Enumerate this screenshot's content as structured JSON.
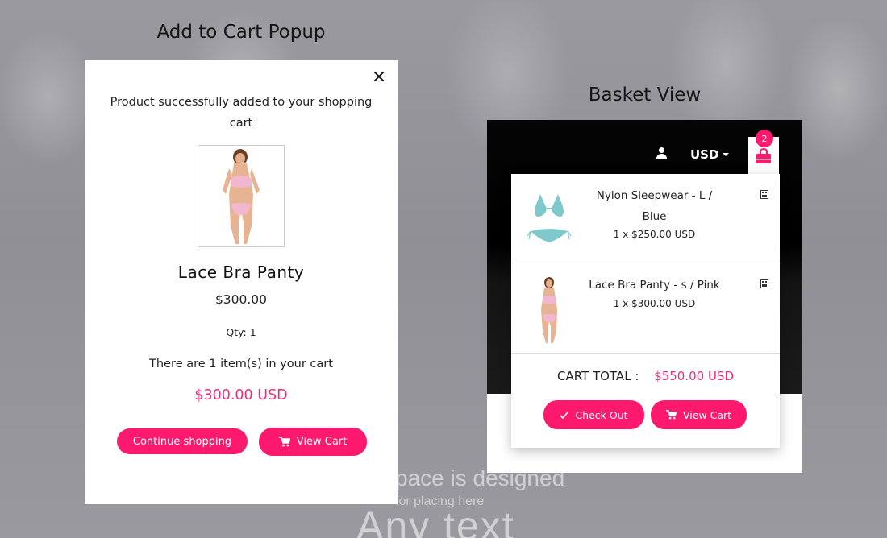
{
  "background": {
    "line1": "pace is designed",
    "line2": "for placing here",
    "line3": "Any  text"
  },
  "titles": {
    "popup": "Add to Cart Popup",
    "basket": "Basket View"
  },
  "popup": {
    "message": "Product successfully added to your shopping cart",
    "product_name": "Lace Bra Panty",
    "price": "$300.00",
    "qty": "Qty: 1",
    "cart_count": "There are 1 item(s) in your cart",
    "total": "$300.00 USD",
    "continue_label": "Continue shopping",
    "view_cart_label": "View Cart",
    "close_icon": "close-icon"
  },
  "basket": {
    "currency": "USD",
    "badge_count": "2",
    "items": [
      {
        "name": "Nylon Sleepwear - L / Blue",
        "price": "1 x $250.00 USD"
      },
      {
        "name": "Lace Bra Panty - s / Pink",
        "price": "1 x $300.00 USD"
      }
    ],
    "total_label": "CART TOTAL :",
    "total_value": "$550.00 USD",
    "checkout_label": "Check Out",
    "view_cart_label": "View Cart"
  },
  "colors": {
    "accent": "#fd1a6e",
    "price_pink": "#ee2c7c",
    "header_black": "#000000"
  }
}
